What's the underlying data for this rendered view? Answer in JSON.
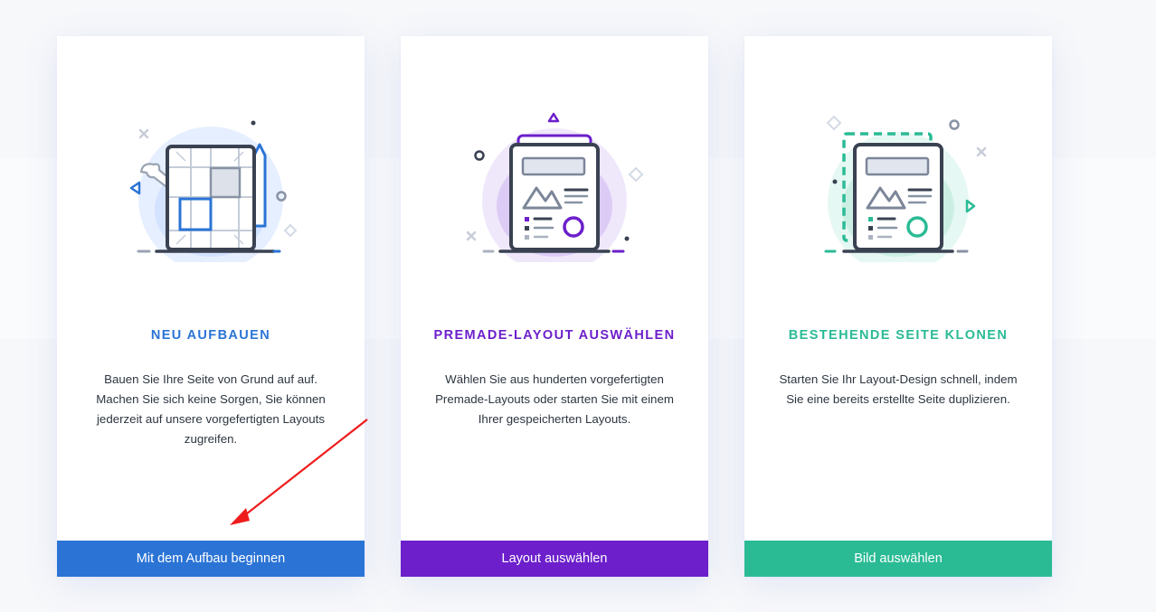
{
  "colors": {
    "blue": "#2b74d6",
    "purple": "#6c1fcb",
    "green": "#2abb95",
    "annotation_arrow": "#ee1c1c"
  },
  "cards": [
    {
      "title": "NEU AUFBAUEN",
      "description": "Bauen Sie Ihre Seite von Grund auf auf. Machen Sie sich keine Sorgen, Sie können jederzeit auf unsere vorgefertigten Layouts zugreifen.",
      "button_label": "Mit dem Aufbau beginnen",
      "icon": "blueprint-grid-icon"
    },
    {
      "title": "PREMADE-LAYOUT AUSWÄHLEN",
      "description": "Wählen Sie aus hunderten vorgefertigten Premade-Layouts oder starten Sie mit einem Ihrer gespeicherten Layouts.",
      "button_label": "Layout auswählen",
      "icon": "layout-document-icon"
    },
    {
      "title": "BESTEHENDE SEITE KLONEN",
      "description": "Starten Sie Ihr Layout-Design schnell, indem Sie eine bereits erstellte Seite duplizieren.",
      "button_label": "Bild auswählen",
      "icon": "clone-page-icon"
    }
  ]
}
